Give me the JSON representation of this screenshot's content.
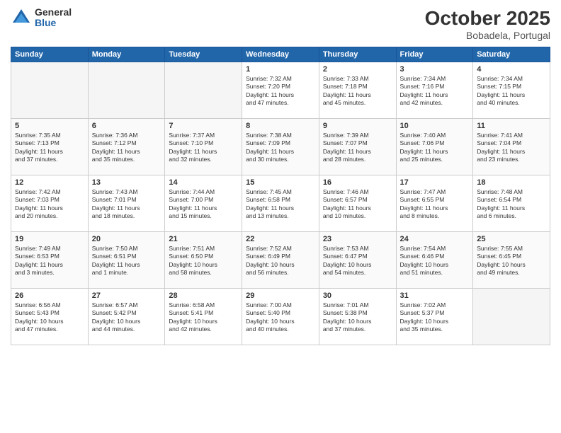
{
  "header": {
    "logo_general": "General",
    "logo_blue": "Blue",
    "title": "October 2025",
    "subtitle": "Bobadela, Portugal"
  },
  "columns": [
    "Sunday",
    "Monday",
    "Tuesday",
    "Wednesday",
    "Thursday",
    "Friday",
    "Saturday"
  ],
  "weeks": [
    {
      "row_class": "row-odd",
      "days": [
        {
          "num": "",
          "info": "",
          "empty": true
        },
        {
          "num": "",
          "info": "",
          "empty": true
        },
        {
          "num": "",
          "info": "",
          "empty": true
        },
        {
          "num": "1",
          "info": "Sunrise: 7:32 AM\nSunset: 7:20 PM\nDaylight: 11 hours\nand 47 minutes.",
          "empty": false
        },
        {
          "num": "2",
          "info": "Sunrise: 7:33 AM\nSunset: 7:18 PM\nDaylight: 11 hours\nand 45 minutes.",
          "empty": false
        },
        {
          "num": "3",
          "info": "Sunrise: 7:34 AM\nSunset: 7:16 PM\nDaylight: 11 hours\nand 42 minutes.",
          "empty": false
        },
        {
          "num": "4",
          "info": "Sunrise: 7:34 AM\nSunset: 7:15 PM\nDaylight: 11 hours\nand 40 minutes.",
          "empty": false
        }
      ]
    },
    {
      "row_class": "row-even",
      "days": [
        {
          "num": "5",
          "info": "Sunrise: 7:35 AM\nSunset: 7:13 PM\nDaylight: 11 hours\nand 37 minutes.",
          "empty": false
        },
        {
          "num": "6",
          "info": "Sunrise: 7:36 AM\nSunset: 7:12 PM\nDaylight: 11 hours\nand 35 minutes.",
          "empty": false
        },
        {
          "num": "7",
          "info": "Sunrise: 7:37 AM\nSunset: 7:10 PM\nDaylight: 11 hours\nand 32 minutes.",
          "empty": false
        },
        {
          "num": "8",
          "info": "Sunrise: 7:38 AM\nSunset: 7:09 PM\nDaylight: 11 hours\nand 30 minutes.",
          "empty": false
        },
        {
          "num": "9",
          "info": "Sunrise: 7:39 AM\nSunset: 7:07 PM\nDaylight: 11 hours\nand 28 minutes.",
          "empty": false
        },
        {
          "num": "10",
          "info": "Sunrise: 7:40 AM\nSunset: 7:06 PM\nDaylight: 11 hours\nand 25 minutes.",
          "empty": false
        },
        {
          "num": "11",
          "info": "Sunrise: 7:41 AM\nSunset: 7:04 PM\nDaylight: 11 hours\nand 23 minutes.",
          "empty": false
        }
      ]
    },
    {
      "row_class": "row-odd",
      "days": [
        {
          "num": "12",
          "info": "Sunrise: 7:42 AM\nSunset: 7:03 PM\nDaylight: 11 hours\nand 20 minutes.",
          "empty": false
        },
        {
          "num": "13",
          "info": "Sunrise: 7:43 AM\nSunset: 7:01 PM\nDaylight: 11 hours\nand 18 minutes.",
          "empty": false
        },
        {
          "num": "14",
          "info": "Sunrise: 7:44 AM\nSunset: 7:00 PM\nDaylight: 11 hours\nand 15 minutes.",
          "empty": false
        },
        {
          "num": "15",
          "info": "Sunrise: 7:45 AM\nSunset: 6:58 PM\nDaylight: 11 hours\nand 13 minutes.",
          "empty": false
        },
        {
          "num": "16",
          "info": "Sunrise: 7:46 AM\nSunset: 6:57 PM\nDaylight: 11 hours\nand 10 minutes.",
          "empty": false
        },
        {
          "num": "17",
          "info": "Sunrise: 7:47 AM\nSunset: 6:55 PM\nDaylight: 11 hours\nand 8 minutes.",
          "empty": false
        },
        {
          "num": "18",
          "info": "Sunrise: 7:48 AM\nSunset: 6:54 PM\nDaylight: 11 hours\nand 6 minutes.",
          "empty": false
        }
      ]
    },
    {
      "row_class": "row-even",
      "days": [
        {
          "num": "19",
          "info": "Sunrise: 7:49 AM\nSunset: 6:53 PM\nDaylight: 11 hours\nand 3 minutes.",
          "empty": false
        },
        {
          "num": "20",
          "info": "Sunrise: 7:50 AM\nSunset: 6:51 PM\nDaylight: 11 hours\nand 1 minute.",
          "empty": false
        },
        {
          "num": "21",
          "info": "Sunrise: 7:51 AM\nSunset: 6:50 PM\nDaylight: 10 hours\nand 58 minutes.",
          "empty": false
        },
        {
          "num": "22",
          "info": "Sunrise: 7:52 AM\nSunset: 6:49 PM\nDaylight: 10 hours\nand 56 minutes.",
          "empty": false
        },
        {
          "num": "23",
          "info": "Sunrise: 7:53 AM\nSunset: 6:47 PM\nDaylight: 10 hours\nand 54 minutes.",
          "empty": false
        },
        {
          "num": "24",
          "info": "Sunrise: 7:54 AM\nSunset: 6:46 PM\nDaylight: 10 hours\nand 51 minutes.",
          "empty": false
        },
        {
          "num": "25",
          "info": "Sunrise: 7:55 AM\nSunset: 6:45 PM\nDaylight: 10 hours\nand 49 minutes.",
          "empty": false
        }
      ]
    },
    {
      "row_class": "row-odd",
      "days": [
        {
          "num": "26",
          "info": "Sunrise: 6:56 AM\nSunset: 5:43 PM\nDaylight: 10 hours\nand 47 minutes.",
          "empty": false
        },
        {
          "num": "27",
          "info": "Sunrise: 6:57 AM\nSunset: 5:42 PM\nDaylight: 10 hours\nand 44 minutes.",
          "empty": false
        },
        {
          "num": "28",
          "info": "Sunrise: 6:58 AM\nSunset: 5:41 PM\nDaylight: 10 hours\nand 42 minutes.",
          "empty": false
        },
        {
          "num": "29",
          "info": "Sunrise: 7:00 AM\nSunset: 5:40 PM\nDaylight: 10 hours\nand 40 minutes.",
          "empty": false
        },
        {
          "num": "30",
          "info": "Sunrise: 7:01 AM\nSunset: 5:38 PM\nDaylight: 10 hours\nand 37 minutes.",
          "empty": false
        },
        {
          "num": "31",
          "info": "Sunrise: 7:02 AM\nSunset: 5:37 PM\nDaylight: 10 hours\nand 35 minutes.",
          "empty": false
        },
        {
          "num": "",
          "info": "",
          "empty": true
        }
      ]
    }
  ]
}
